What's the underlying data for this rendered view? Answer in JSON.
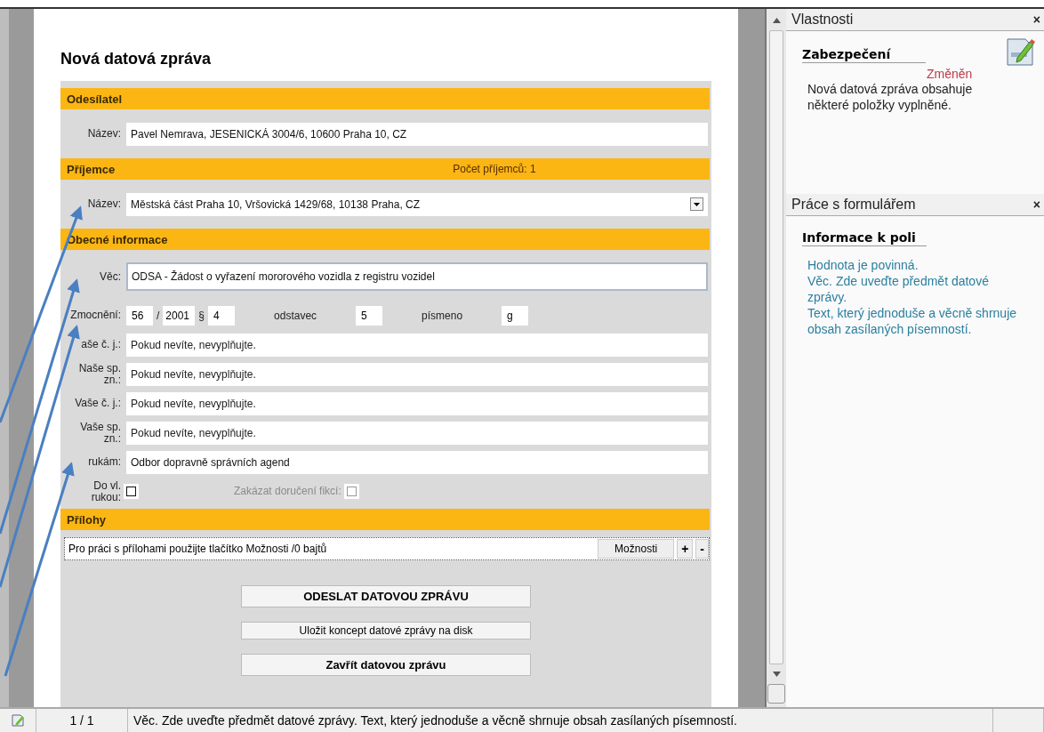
{
  "document": {
    "title": "Nová datová zpráva",
    "sections": [
      {
        "title": "Odesílatel",
        "fields": [
          {
            "kind": "text",
            "label": "Název:",
            "value": "Pavel Nemrava, JESENICKÁ 3004/6, 10600 Praha 10, CZ"
          }
        ]
      },
      {
        "title": "Příjemce",
        "note": "Počet příjemců:  1",
        "fields": [
          {
            "kind": "select",
            "label": "Název:",
            "value": "Městská část Praha 10, Vršovická 1429/68, 10138 Praha, CZ"
          }
        ]
      },
      {
        "title": "Obecné informace",
        "fields": [
          {
            "kind": "text",
            "label": "Věc:",
            "value": "ODSA - Žádost o vyřazení mororového vozidla z registru vozidel",
            "focused": true
          },
          {
            "kind": "authority",
            "label": "Zmocnění:",
            "parts": [
              {
                "value": "56"
              },
              {
                "text": "/"
              },
              {
                "value": "2001"
              },
              {
                "text": "§"
              },
              {
                "value": "4"
              },
              {
                "text": "odstavec"
              },
              {
                "value": "5"
              },
              {
                "text": "písmeno"
              },
              {
                "value": "g"
              }
            ]
          },
          {
            "kind": "text",
            "label": "aše č. j.:",
            "placeholder": "Pokud nevíte, nevyplňujte."
          },
          {
            "kind": "text",
            "label": "Naše sp. zn.:",
            "placeholder": "Pokud nevíte, nevyplňujte."
          },
          {
            "kind": "text",
            "label": "Vaše č. j.:",
            "placeholder": "Pokud nevíte, nevyplňujte."
          },
          {
            "kind": "text",
            "label": "Vaše sp. zn.:",
            "placeholder": "Pokud nevíte, nevyplňujte."
          },
          {
            "kind": "text",
            "label": "rukám:",
            "value": "Odbor dopravně správních agend"
          },
          {
            "kind": "checks",
            "items": [
              {
                "label": "Do vl. rukou:",
                "checked": false,
                "disabled": false
              },
              {
                "label": "Zakázat doručení fikcí:",
                "checked": false,
                "disabled": true
              }
            ]
          }
        ]
      },
      {
        "title": "Přílohy",
        "fields": [
          {
            "kind": "attachments",
            "text": "Pro práci s přílohami použijte tlačítko Možnosti /0 bajtů",
            "buttons": [
              "Možnosti",
              "+",
              "-"
            ]
          }
        ]
      }
    ],
    "actions": [
      {
        "label": "ODESLAT DATOVOU ZPRÁVU",
        "kind": "primary"
      },
      {
        "label": "Uložit koncept datové zprávy na disk",
        "kind": "secondary"
      },
      {
        "label": "Zavřít datovou zprávu",
        "kind": "primary"
      }
    ]
  },
  "side_panels": [
    {
      "title": "Vlastnosti",
      "close": "×",
      "heading": "Zabezpečení",
      "status": "Změněn",
      "lines": [
        "Nová datová zpráva obsahuje některé položky vyplněné."
      ]
    },
    {
      "title": "Práce s formulářem",
      "close": "×",
      "heading": "Informace k poli",
      "lines": [
        "Hodnota je povinná.",
        "Věc. Zde uveďte předmět datové zprávy.",
        "Text, který jednoduše a věcně shrnuje obsah zasílaných písemností."
      ]
    }
  ],
  "status_bar": {
    "page": "1 / 1",
    "message": "Věc. Zde uveďte předmět datové zprávy.  Text, který jednoduše a věcně shrnuje obsah zasílaných písemností."
  }
}
